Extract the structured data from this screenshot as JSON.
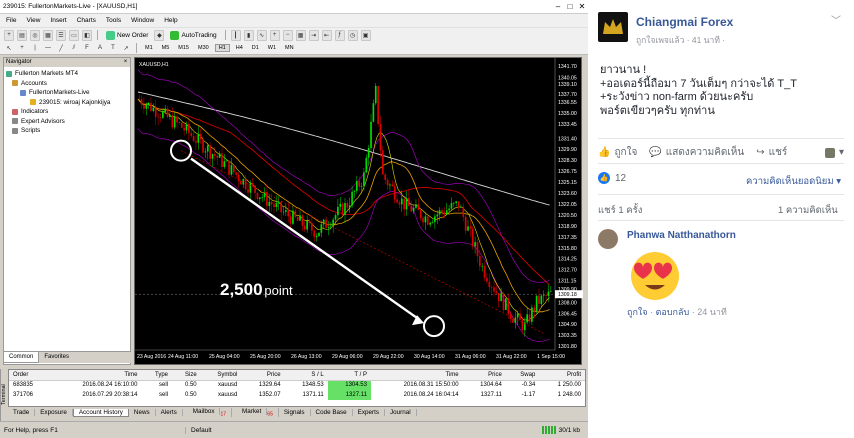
{
  "mt4": {
    "window_title": "239015: FullertonMarkets-Live - [XAUUSD,H1]",
    "menu": [
      "File",
      "View",
      "Insert",
      "Charts",
      "Tools",
      "Window",
      "Help"
    ],
    "toolbar": {
      "new_order": "New Order",
      "autotrading": "AutoTrading"
    },
    "timeframes": [
      "M1",
      "M5",
      "M15",
      "M30",
      "H1",
      "H4",
      "D1",
      "W1",
      "MN"
    ],
    "navigator": {
      "title": "Navigator",
      "items": [
        "Fullerton Markets MT4",
        "Accounts",
        "FullertonMarkets-Live",
        "239015: wiroaj Kajonkijya",
        "Indicators",
        "Expert Advisors",
        "Scripts"
      ],
      "tabs": [
        "Common",
        "Favorites"
      ]
    },
    "chart": {
      "label": "XAUUSD,H1",
      "annotation_value": "2,500",
      "annotation_unit": "point",
      "price_labels": [
        "1341.70",
        "1340.05",
        "1339.10",
        "1337.70",
        "1336.55",
        "1335.00",
        "1333.45",
        "1331.40",
        "1329.90",
        "1328.30",
        "1326.75",
        "1325.15",
        "1323.60",
        "1322.05",
        "1320.50",
        "1318.90",
        "1317.35",
        "1315.80",
        "1314.25",
        "1312.70",
        "1311.15",
        "1309.90",
        "1308.00",
        "1306.45",
        "1304.90",
        "1303.35",
        "1301.80"
      ],
      "current_price": "1309.18",
      "time_labels": [
        "23 Aug 2016",
        "24 Aug 11:00",
        "25 Aug 04:00",
        "25 Aug 20:00",
        "26 Aug 13:00",
        "29 Aug 06:00",
        "29 Aug 22:00",
        "30 Aug 14:00",
        "31 Aug 06:00",
        "31 Aug 22:00",
        "1 Sep 15:00"
      ]
    },
    "terminal": {
      "side_label": "Terminal",
      "headers": [
        "Order",
        "Time",
        "Type",
        "Size",
        "Symbol",
        "Price",
        "S / L",
        "T / P",
        "Time",
        "Price",
        "Swap",
        "Profit"
      ],
      "rows": [
        [
          "683835",
          "2016.08.24 16:10:00",
          "sell",
          "0.50",
          "xauusd",
          "1329.64",
          "1348.53",
          "1304.53",
          "2016.08.31 15:50:00",
          "1304.64",
          "-0.34",
          "1 250.00"
        ],
        [
          "371706",
          "2016.07.29 20:38:14",
          "sell",
          "0.50",
          "xauusd",
          "1352.07",
          "1371.11",
          "1327.11",
          "2016.08.24 16:04:14",
          "1327.11",
          "-1.17",
          "1 248.00"
        ]
      ],
      "tabs": [
        "Trade",
        "Exposure",
        "Account History",
        "News",
        "Alerts",
        "Mailbox",
        "Market",
        "Signals",
        "Code Base",
        "Experts",
        "Journal"
      ],
      "mailbox_badge": "17",
      "market_badge": "65"
    },
    "status": {
      "help": "For Help, press F1",
      "profile": "Default",
      "traffic": "30/1 kb"
    }
  },
  "post": {
    "page_name": "Chiangmai Forex",
    "meta": "ถูกใจเพจแล้ว · 41 นาที ·",
    "text_lines": [
      "ยาวนาน !",
      "+ออเดอร์นี้ถือมา 7 วันเต็มๆ กว่าจะได้ T_T",
      "+ระวังข่าว non-farm ด้วยนะครับ",
      "พอร์ตเขียวๆครับ ทุกท่าน"
    ],
    "actions": [
      "ถูกใจ",
      "แสดงความคิดเห็น",
      "แชร์"
    ],
    "like_count": "12",
    "sort_label": "ความคิดเห็นยอดนิยม ▾",
    "shares": "แชร์ 1 ครั้ง",
    "comments_count": "1 ความคิดเห็น",
    "comment": {
      "author": "Phanwa Natthanathorn",
      "actions": [
        "ถูกใจ",
        "ตอบกลับ",
        "24 นาที"
      ]
    }
  },
  "colors": {
    "fb_blue": "#385898",
    "like_blue": "#1877f2",
    "candle_up": "#00e000",
    "candle_down": "#e00000"
  }
}
